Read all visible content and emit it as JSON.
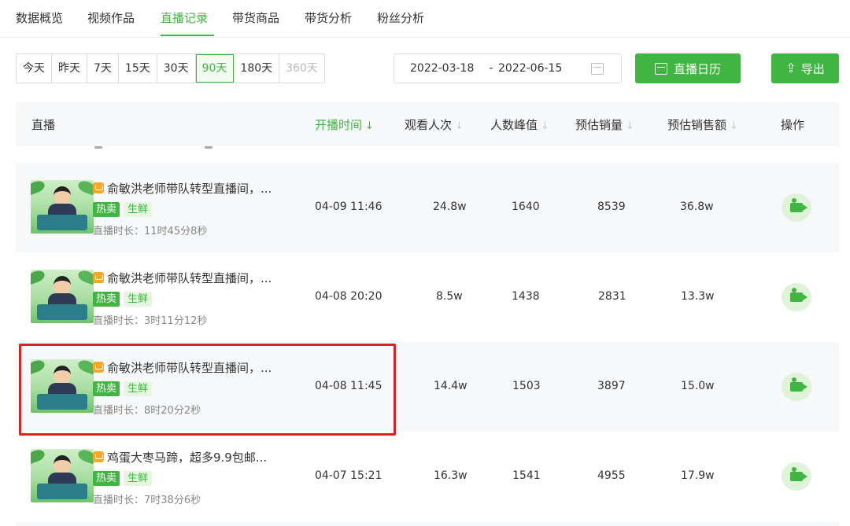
{
  "nav": {
    "tabs": [
      {
        "label": "数据概览"
      },
      {
        "label": "视频作品"
      },
      {
        "label": "直播记录"
      },
      {
        "label": "带货商品"
      },
      {
        "label": "带货分析"
      },
      {
        "label": "粉丝分析"
      }
    ],
    "active_tab": "直播记录"
  },
  "filters": {
    "ranges": [
      "今天",
      "昨天",
      "7天",
      "15天",
      "30天",
      "90天",
      "180天",
      "360天"
    ],
    "active_range": "90天",
    "disabled_range": "360天",
    "date_start": "2022-03-18",
    "date_separator": "-",
    "date_end": "2022-06-15",
    "calendar_button": "直播日历",
    "export_button": "导出"
  },
  "table": {
    "headers": {
      "live": "直播",
      "start_time": "开播时间",
      "views": "观看人次",
      "peak": "人数峰值",
      "est_sales": "预估销量",
      "est_revenue": "预估销售额",
      "action": "操作"
    },
    "sorted_column": "开播时间",
    "rows": [
      {
        "title": "俞敏洪老师带队转型直播间，...",
        "tag_hot": "热卖",
        "tag_category": "生鲜",
        "duration": "直播时长：11时45分8秒",
        "start_time": "04-09 11:46",
        "views": "24.8w",
        "peak": "1640",
        "est_sales": "8539",
        "est_revenue": "36.8w"
      },
      {
        "title": "俞敏洪老师带队转型直播间，...",
        "tag_hot": "热卖",
        "tag_category": "生鲜",
        "duration": "直播时长：3时11分12秒",
        "start_time": "04-08 20:20",
        "views": "8.5w",
        "peak": "1438",
        "est_sales": "2831",
        "est_revenue": "13.3w"
      },
      {
        "title": "俞敏洪老师带队转型直播间，...",
        "tag_hot": "热卖",
        "tag_category": "生鲜",
        "duration": "直播时长：8时20分2秒",
        "start_time": "04-08 11:45",
        "views": "14.4w",
        "peak": "1503",
        "est_sales": "3897",
        "est_revenue": "15.0w"
      },
      {
        "title": "鸡蛋大枣马蹄，超多9.9包邮...",
        "tag_hot": "热卖",
        "tag_category": "生鲜",
        "duration": "直播时长：7时38分6秒",
        "start_time": "04-07 15:21",
        "views": "16.3w",
        "peak": "1541",
        "est_sales": "4955",
        "est_revenue": "17.9w"
      }
    ]
  },
  "colors": {
    "accent": "#41b541",
    "tag_bg": "#e6f6e2",
    "highlight": "#e02020"
  },
  "icons": [
    "calendar-icon",
    "export-icon",
    "shop-icon",
    "camera-icon",
    "sort-arrow-icon"
  ]
}
